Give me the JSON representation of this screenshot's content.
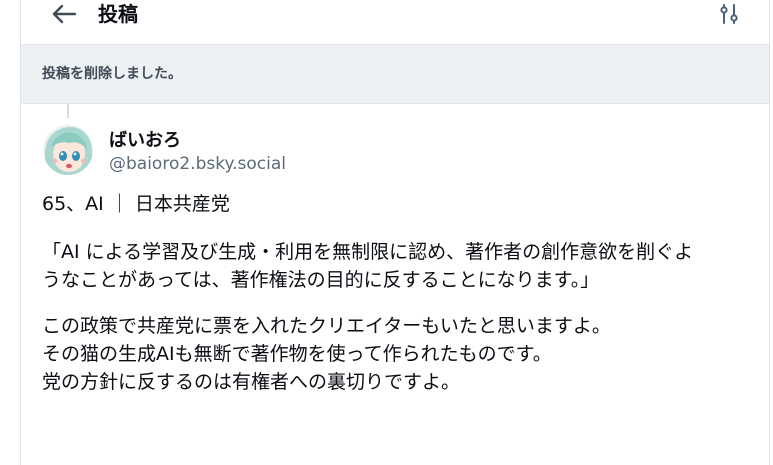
{
  "header": {
    "title": "投稿"
  },
  "notice": {
    "deleted_text": "投稿を削除しました。"
  },
  "post": {
    "display_name": "ばいおろ",
    "handle": "@baioro2.bsky.social",
    "lines": [
      "65、AI ｜ 日本共産党",
      "「AI による学習及び生成・利用を無制限に認め、著作者の創作意欲を削ぐよ",
      "うなことがあっては、著作権法の目的に反することになります。」",
      "この政策で共産党に票を入れたクリエイターもいたと思いますよ。",
      "その猫の生成AIも無断で著作物を使って作られたものです。",
      "党の方針に反するのは有権者への裏切りですよ。"
    ]
  },
  "icons": {
    "back": "arrow-left-icon",
    "settings": "sliders-icon",
    "avatar": "anime-avatar"
  },
  "colors": {
    "banner_bg": "#eef1f4",
    "handle": "#5b6b7a",
    "text": "#0b0f14"
  }
}
